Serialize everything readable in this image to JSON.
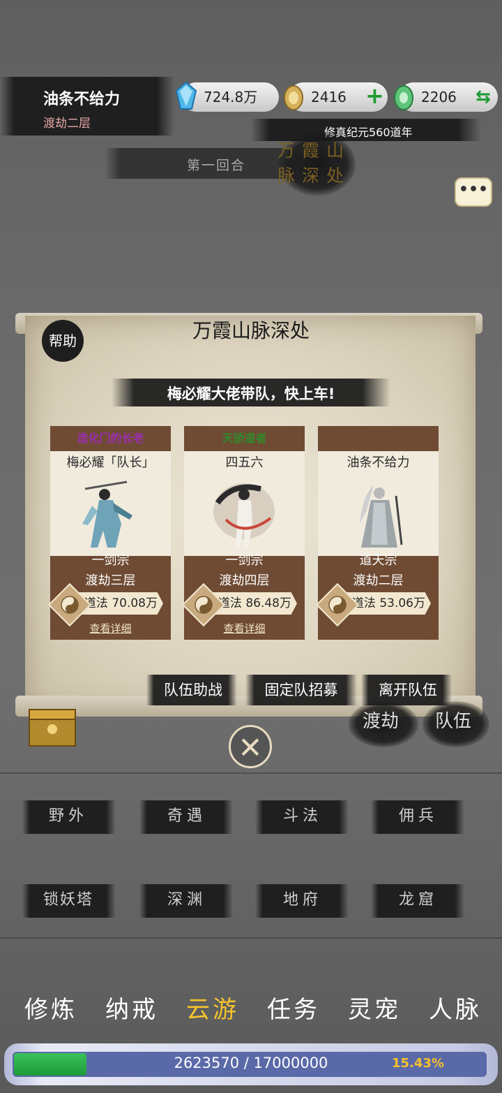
{
  "header": {
    "player_name": "油条不给力",
    "player_rank": "渡劫二层",
    "era": "修真纪元560道年",
    "round": "第一回合",
    "location": "万霞山脉深处"
  },
  "resources": [
    {
      "name": "spirit-stone",
      "value": "724.8万"
    },
    {
      "name": "gold-ingot",
      "value": "2416",
      "action": "+"
    },
    {
      "name": "jade",
      "value": "2206",
      "action": "⇆"
    }
  ],
  "panel": {
    "title": "万霞山脉深处",
    "help": "帮助",
    "banner": "梅必耀大佬带队，快上车!",
    "members": [
      {
        "title": "造化门的长老",
        "title_color": "#9b2fb0",
        "name": "梅必耀「队长」",
        "sect": "一剑宗",
        "realm": "渡劫三层",
        "power": "道法 70.08万",
        "detail": "查看详细"
      },
      {
        "title": "天骄道者",
        "title_color": "#2f8a2a",
        "name": "四五六",
        "sect": "一剑宗",
        "realm": "渡劫四层",
        "power": "道法 86.48万",
        "detail": "查看详细"
      },
      {
        "title": "",
        "title_color": "#6f4b33",
        "name": "油条不给力",
        "sect": "道天宗",
        "realm": "渡劫二层",
        "power": "道法 53.06万",
        "detail": ""
      }
    ],
    "buttons": [
      "队伍助战",
      "固定队招募",
      "离开队伍"
    ]
  },
  "side_buttons": [
    "渡劫",
    "队伍"
  ],
  "menu": [
    "野外",
    "奇遇",
    "斗法",
    "佣兵",
    "锁妖塔",
    "深渊",
    "地府",
    "龙窟"
  ],
  "nav": {
    "items": [
      "修炼",
      "纳戒",
      "云游",
      "任务",
      "灵宠",
      "人脉"
    ],
    "active": "云游"
  },
  "xp": {
    "text": "2623570 / 17000000",
    "percent": "15.43%",
    "fraction": 0.1543
  },
  "colors": {
    "accent": "#f6c32b",
    "card_brown": "#6f4b33",
    "xp_green": "#2fae4a"
  }
}
